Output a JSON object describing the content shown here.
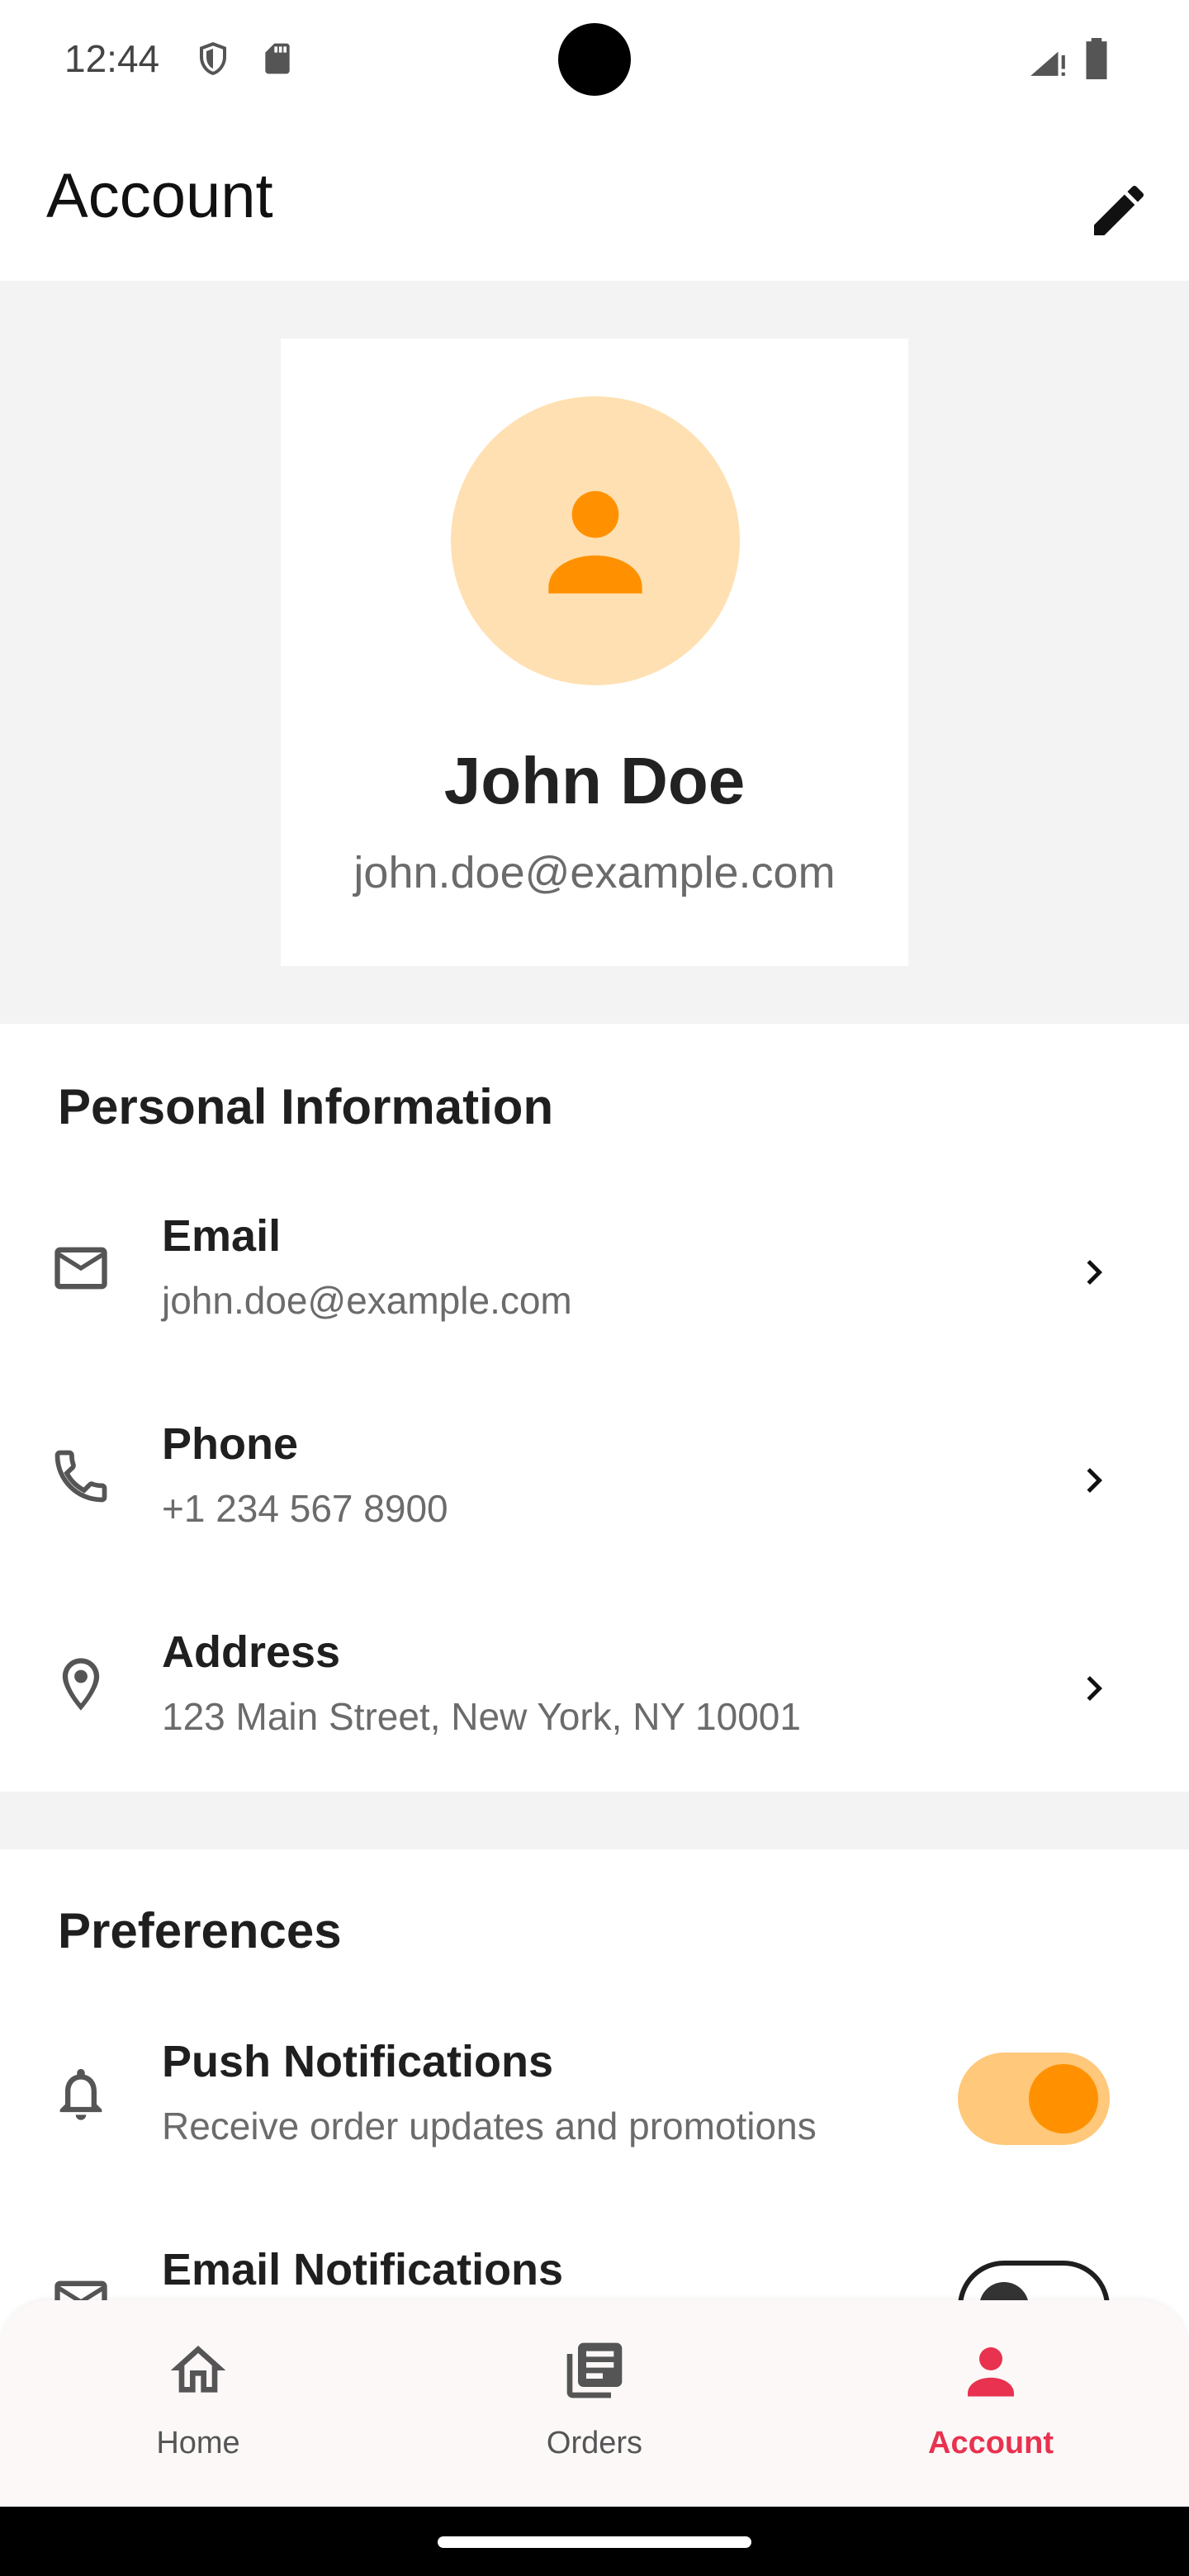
{
  "status_bar": {
    "time": "12:44"
  },
  "app_bar": {
    "title": "Account"
  },
  "profile": {
    "name": "John Doe",
    "email": "john.doe@example.com"
  },
  "personal": {
    "title": "Personal Information",
    "items": [
      {
        "label": "Email",
        "value": "john.doe@example.com",
        "icon": "mail-icon"
      },
      {
        "label": "Phone",
        "value": "+1 234 567 8900",
        "icon": "phone-icon"
      },
      {
        "label": "Address",
        "value": "123 Main Street, New York, NY 10001",
        "icon": "location-pin-icon"
      }
    ]
  },
  "preferences": {
    "title": "Preferences",
    "items": [
      {
        "label": "Push Notifications",
        "description": "Receive order updates and promotions",
        "enabled": true,
        "icon": "bell-icon"
      },
      {
        "label": "Email Notifications",
        "enabled": false,
        "icon": "mail-icon"
      }
    ]
  },
  "bottom_nav": {
    "items": [
      {
        "label": "Home",
        "icon": "home-icon"
      },
      {
        "label": "Orders",
        "icon": "orders-icon"
      },
      {
        "label": "Account",
        "icon": "person-icon",
        "active": true
      }
    ]
  },
  "colors": {
    "accent": "#ff9100",
    "accent_light": "#ffe0b2",
    "nav_active": "#e8324f"
  }
}
